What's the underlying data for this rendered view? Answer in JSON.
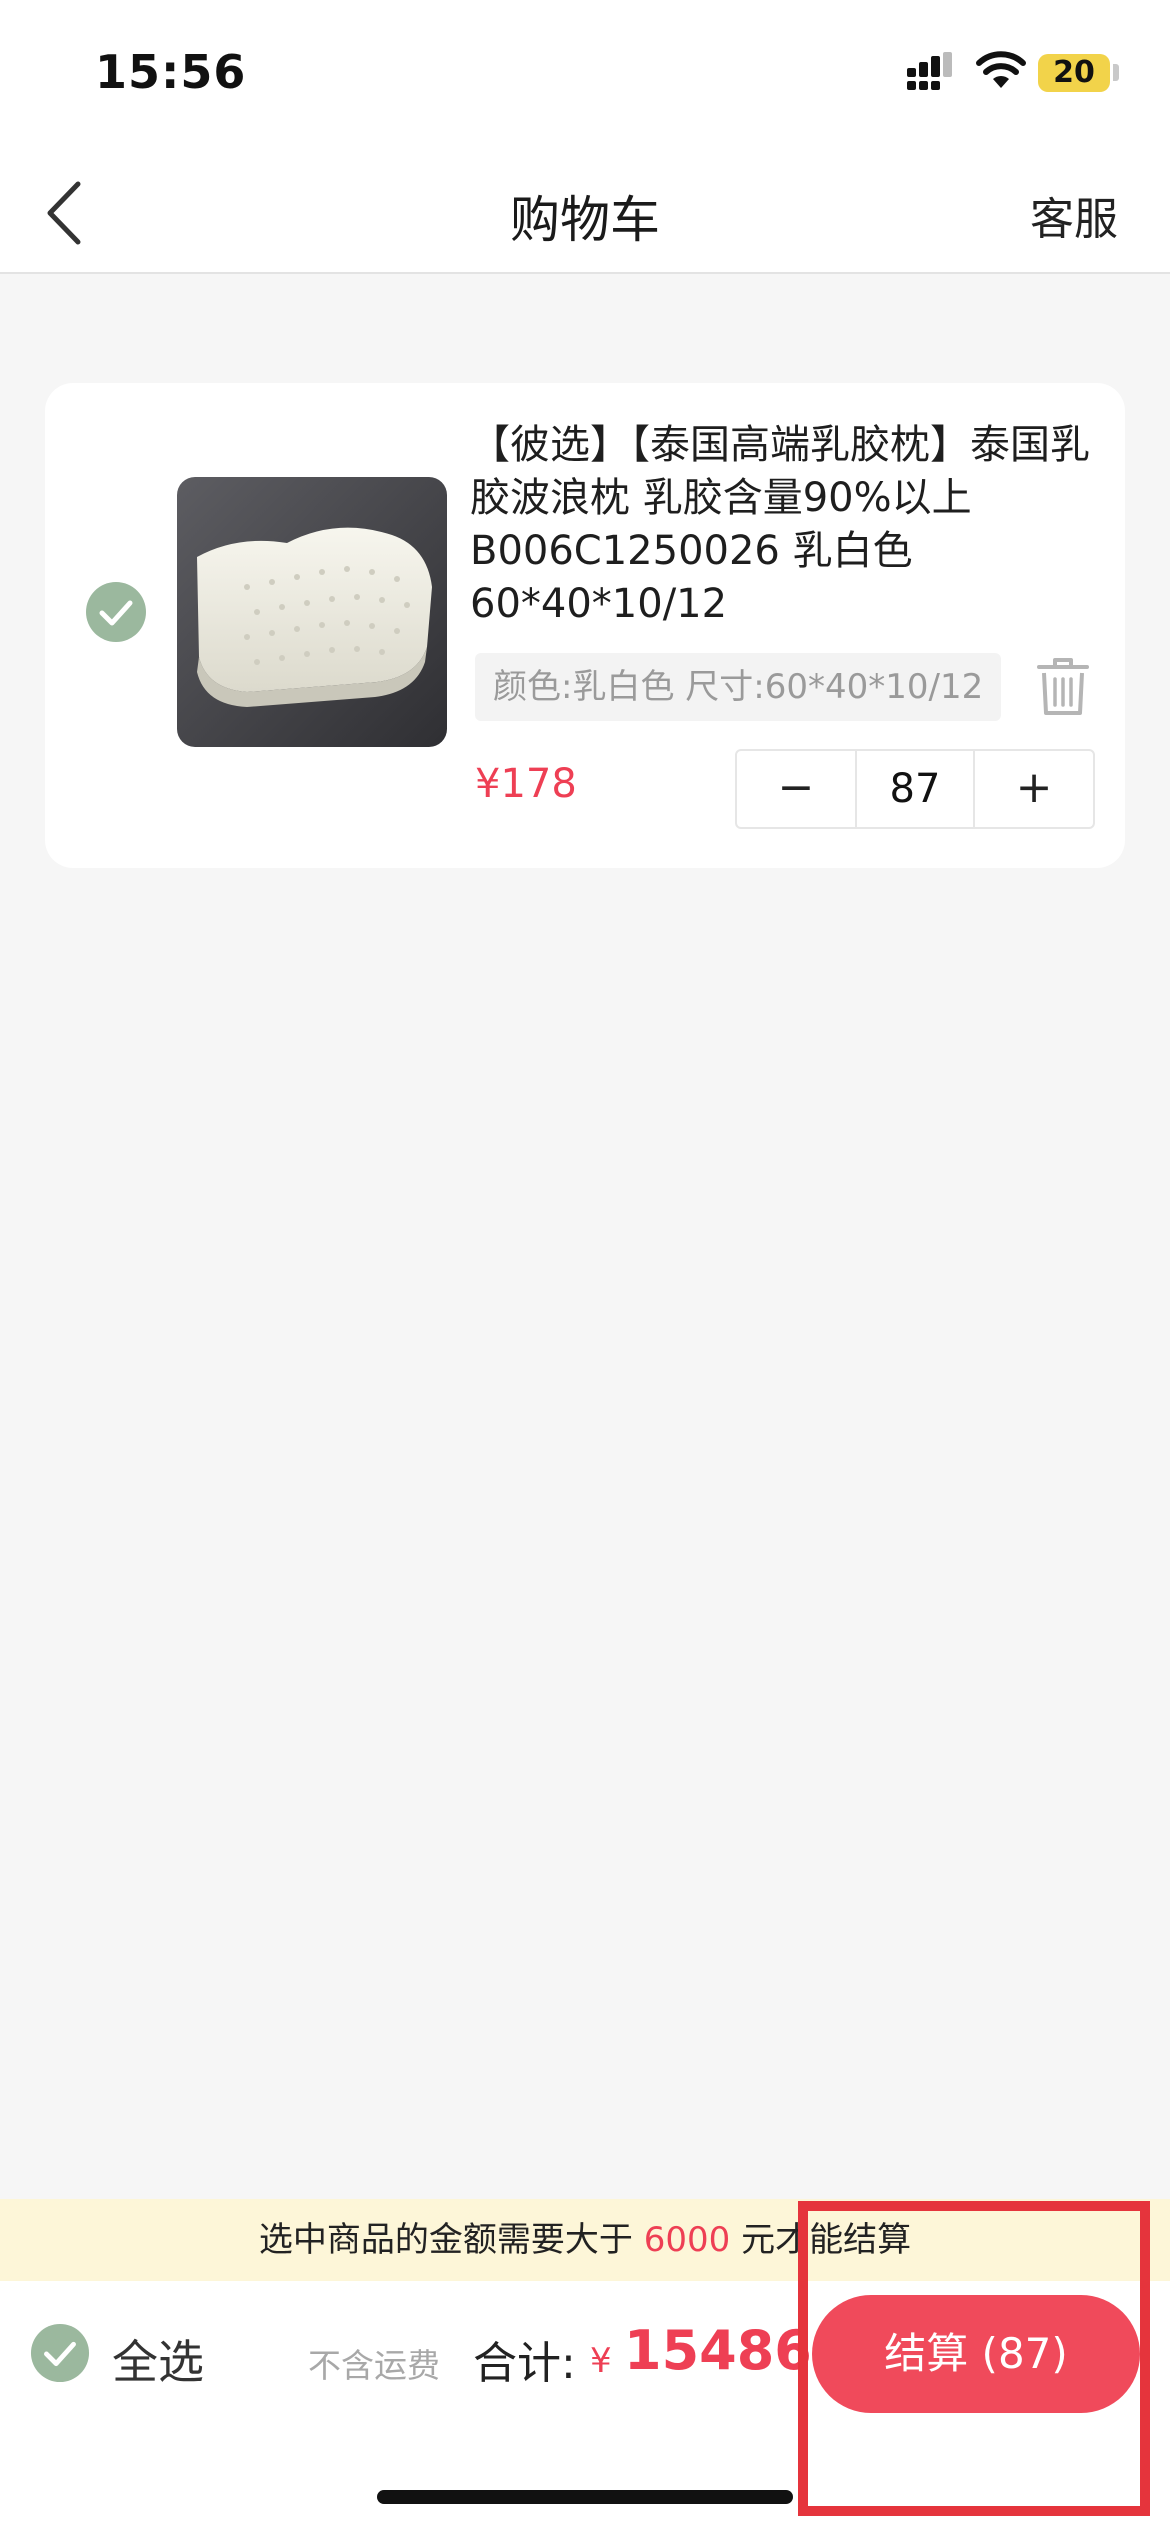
{
  "status_bar": {
    "time": "15:56",
    "battery": "20"
  },
  "nav": {
    "title": "购物车",
    "service": "客服"
  },
  "cart": {
    "items": [
      {
        "title": "【彼选】【泰国高端乳胶枕】泰国乳胶波浪枕 乳胶含量90%以上 B006C1250026 乳白色60*40*10/12",
        "spec": "颜色:乳白色 尺寸:60*40*10/12",
        "price": "¥178",
        "quantity": "87",
        "minus": "−",
        "plus": "+",
        "selected": true
      }
    ]
  },
  "notice": {
    "prefix": "选中商品的金额需要大于",
    "amount": "6000",
    "suffix": "元才能结算"
  },
  "footer": {
    "select_all": "全选",
    "shipping_note": "不含运费",
    "total_label": "合计:",
    "currency": "¥",
    "total_value": "15486",
    "checkout": "结算 (87)"
  },
  "colors": {
    "accent": "#ee3f54",
    "checkbox": "#9bb89e",
    "notice_bg": "#fdf6d8",
    "highlight": "#e5343c"
  }
}
